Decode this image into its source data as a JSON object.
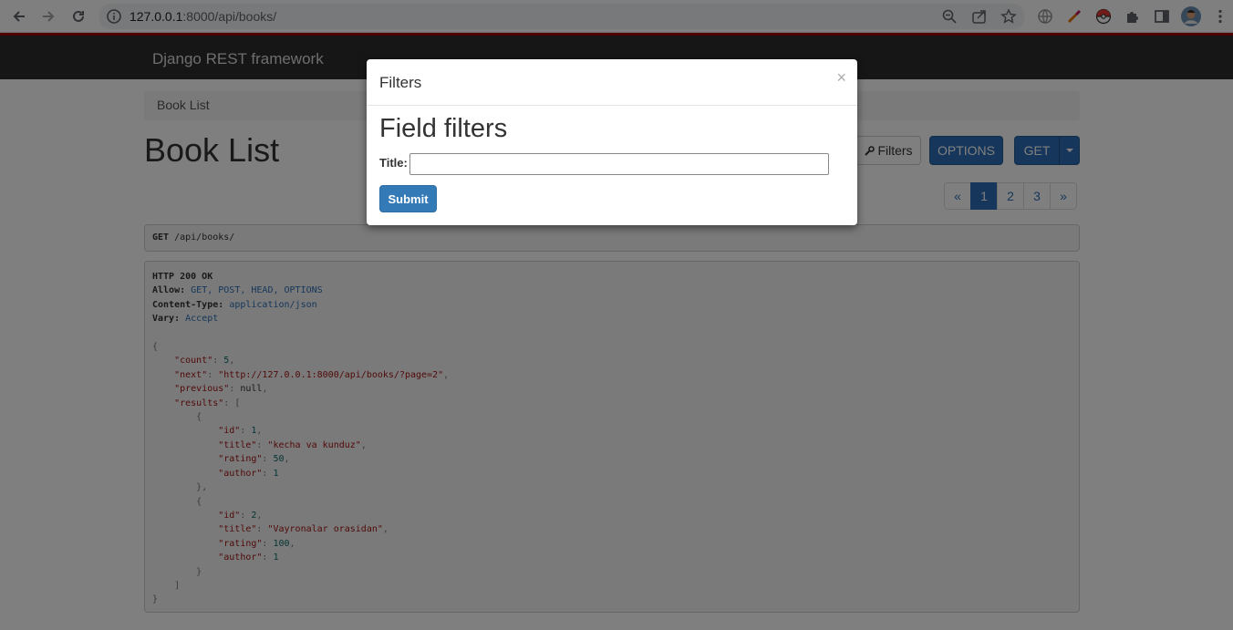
{
  "browser": {
    "url_host": "127.0.0.1",
    "url_rest": ":8000/api/books/"
  },
  "page": {
    "brand": "Django REST framework",
    "breadcrumb": "Book List",
    "title": "Book List",
    "buttons": {
      "filters": "Filters",
      "options": "OPTIONS",
      "get": "GET"
    },
    "pagination": {
      "prev": "«",
      "pages": [
        "1",
        "2",
        "3"
      ],
      "active": "1",
      "next": "»"
    },
    "request": {
      "method": "GET",
      "path": "/api/books/"
    },
    "response": {
      "status": "HTTP 200 OK",
      "allow_label": "Allow:",
      "allow_value": "GET, POST, HEAD, OPTIONS",
      "content_type_label": "Content-Type:",
      "content_type_value": "application/json",
      "vary_label": "Vary:",
      "vary_value": "Accept",
      "body": {
        "count": "5",
        "next": "\"http://127.0.0.1:8000/api/books/?page=2\"",
        "previous": "null",
        "results": [
          {
            "id": "1",
            "title": "\"kecha va kunduz\"",
            "rating": "50",
            "author": "1"
          },
          {
            "id": "2",
            "title": "\"Vayronalar orasidan\"",
            "rating": "100",
            "author": "1"
          }
        ]
      }
    }
  },
  "modal": {
    "title": "Filters",
    "close": "×",
    "heading": "Field filters",
    "field_label": "Title:",
    "field_value": "",
    "submit": "Submit"
  },
  "colors": {
    "primary": "#337ab7",
    "navbar": "#2c2c2c",
    "accent_line": "#a30000"
  }
}
